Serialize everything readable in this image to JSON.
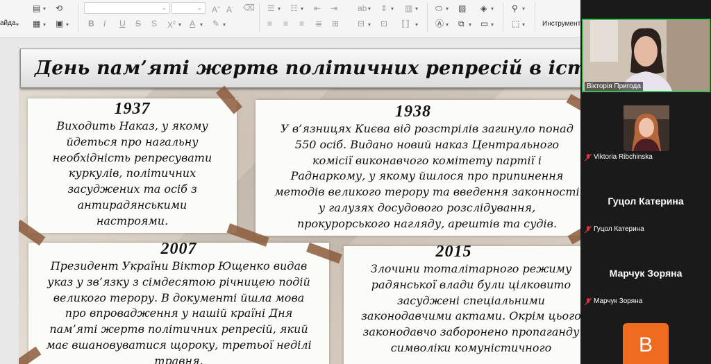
{
  "toolbar": {
    "slide_menu_label": "айда",
    "tools_label": "Инструмент"
  },
  "slide": {
    "title": "День пам’яті жертв політичних репресій в історії",
    "cards": [
      {
        "year": "1937",
        "lines": [
          "Виходить Наказ, у якому",
          "йдеться про нагальну",
          "необхідність репресувати",
          "куркулів, політичних",
          "засуджених та осіб з",
          "антирадянськими",
          "настроями."
        ]
      },
      {
        "year": "1938",
        "lines": [
          "У в’язницях Києва від розстрілів загинуло понад",
          "550 осіб. Видано новий наказ Центрального",
          "комісії виконавчого комітету партії і",
          "Раднаркому, у якому йшлося про припинення",
          "методів великого терору та введення законності",
          "у галузях досудового розслідування,",
          "прокурорського нагляду, арештів та судів."
        ]
      },
      {
        "year": "2007",
        "lines": [
          "Президент України Віктор Ющенко видав",
          "указ у зв’язку з сімдесятою річницею подій",
          "великого терору. В документі йшла мова",
          "про впровадження у нашій країні Дня",
          "пам’яті жертв політичних репресій, який",
          "має вшановуватися щороку, третьої неділі",
          "травня."
        ]
      },
      {
        "year": "2015",
        "lines": [
          "Злочини тоталітарного режиму",
          "радянської влади були цілковито",
          "засуджені спеціальними",
          "законодавчими актами. Окрім цього",
          "законодавчо заборонено пропаганду",
          "символіки комуністичного"
        ]
      }
    ]
  },
  "participants": {
    "speaker": {
      "name": "Вікторія Пригода"
    },
    "list": [
      {
        "name": "Viktoria Ribchinska"
      },
      {
        "display": "Гуцол Катерина",
        "name": "Гуцол Катерина"
      },
      {
        "display": "Марчук Зоряна",
        "name": "Марчук Зоряна"
      }
    ],
    "avatar_letter": "B"
  },
  "colors": {
    "active_speaker_border": "#2fc84b",
    "avatar_bg": "#ef6b1f",
    "mic_off": "#e0333b",
    "tape": "#8b5a3b"
  }
}
